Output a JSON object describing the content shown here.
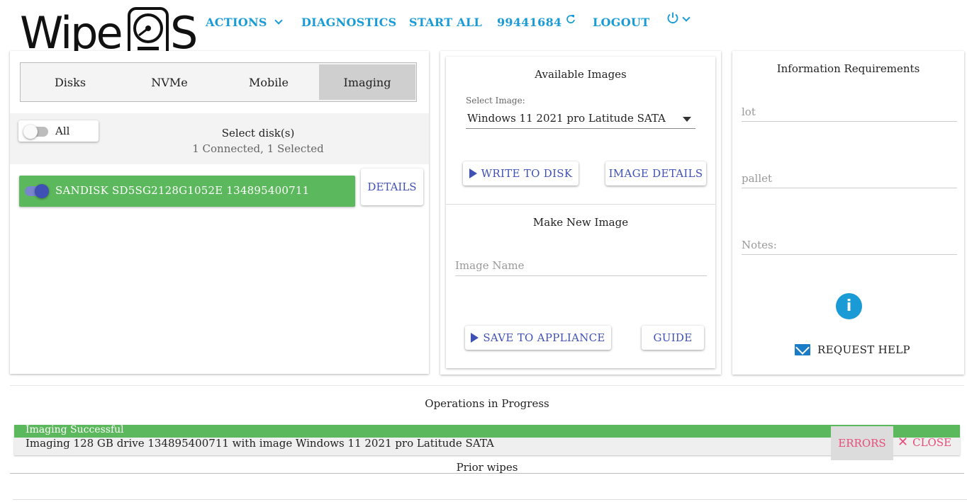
{
  "brand": {
    "logo_text": "Wipe",
    "logo_end": "S"
  },
  "nav": {
    "actions": "ACTIONS",
    "diagnostics": "DIAGNOSTICS",
    "start_all": "START ALL",
    "station_id": "99441684",
    "logout": "LOGOUT",
    "accent_color": "#1a9bd6"
  },
  "tabs": [
    {
      "label": "Disks",
      "active": false
    },
    {
      "label": "NVMe",
      "active": false
    },
    {
      "label": "Mobile",
      "active": false
    },
    {
      "label": "Imaging",
      "active": true
    }
  ],
  "selection": {
    "all_label": "All",
    "all_checked": false,
    "title": "Select disk(s)",
    "summary": "1 Connected, 1 Selected"
  },
  "disks": [
    {
      "label": "SANDISK SD5SG2128G1052E 134895400711",
      "selected": true,
      "status_color": "#5cb85c"
    }
  ],
  "details_label": "DETAILS",
  "available_images": {
    "title": "Available Images",
    "select_label": "Select Image:",
    "selected_image": "Windows 11 2021 pro Latitude SATA",
    "write_label": "WRITE TO DISK",
    "details_label": "IMAGE DETAILS"
  },
  "new_image": {
    "title": "Make New Image",
    "name_placeholder": "Image Name",
    "save_label": "SAVE TO APPLIANCE",
    "guide_label": "GUIDE"
  },
  "info": {
    "title": "Information Requirements",
    "lot_placeholder": "lot",
    "pallet_placeholder": "pallet",
    "notes_placeholder": "Notes:",
    "info_glyph": "i",
    "help_label": "REQUEST HELP"
  },
  "operations": {
    "title": "Operations in Progress",
    "items": [
      {
        "status": "Imaging Successful",
        "text": "Imaging 128 GB drive 134895400711 with image Windows 11 2021 pro Latitude SATA",
        "errors_label": "ERRORS",
        "close_label": "CLOSE",
        "status_color": "#5cb85c"
      }
    ]
  },
  "prior_wipes": "Prior wipes"
}
